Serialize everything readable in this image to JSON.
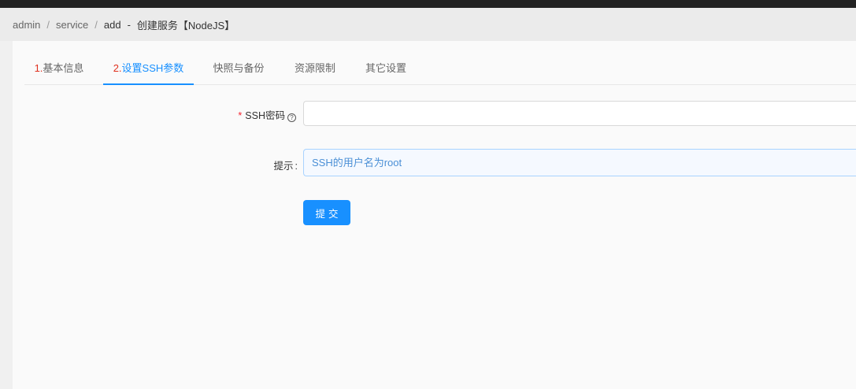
{
  "breadcrumb": {
    "items": [
      "admin",
      "service",
      "add"
    ],
    "separator": "/",
    "current_sep": "-",
    "current_title": "创建服务【NodeJS】"
  },
  "tabs": [
    {
      "num": "1.",
      "label": "基本信息"
    },
    {
      "num": "2.",
      "label": "设置SSH参数"
    },
    {
      "num": "",
      "label": "快照与备份"
    },
    {
      "num": "",
      "label": "资源限制"
    },
    {
      "num": "",
      "label": "其它设置"
    }
  ],
  "active_tab": 1,
  "form": {
    "ssh_password_label": "SSH密码",
    "required_mark": "*",
    "help_glyph": "?",
    "ssh_password_value": "",
    "hint_label": "提示",
    "hint_colon": ":",
    "hint_text": "SSH的用户名为root",
    "submit_label": "提交"
  },
  "colors": {
    "primary": "#1890ff",
    "required": "#f5222d",
    "tab_number": "#e0311f"
  }
}
